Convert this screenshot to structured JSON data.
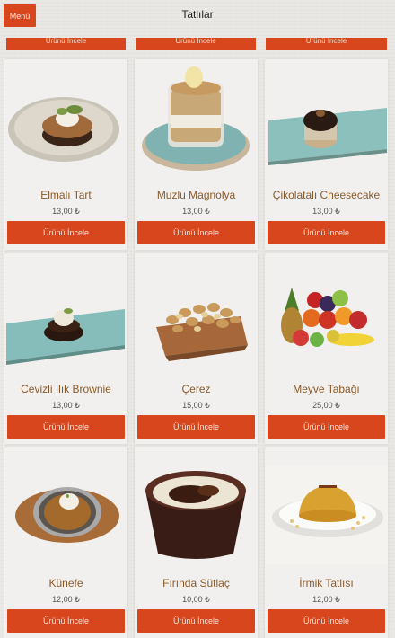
{
  "header": {
    "menu_label": "Menü",
    "title": "Tatlılar"
  },
  "top_strip_label": "Ürünü İncele",
  "products": [
    {
      "name": "Elmalı Tart",
      "price": "13,00 ₺",
      "button": "Ürünü İncele",
      "image": "apple-tart-photo"
    },
    {
      "name": "Muzlu Magnolya",
      "price": "13,00 ₺",
      "button": "Ürünü İncele",
      "image": "banana-magnolia-photo"
    },
    {
      "name": "Çikolatalı Cheesecake",
      "price": "13,00 ₺",
      "button": "Ürünü İncele",
      "image": "chocolate-cheesecake-photo"
    },
    {
      "name": "Cevizli Ilık Brownie",
      "price": "13,00 ₺",
      "button": "Ürünü İncele",
      "image": "walnut-brownie-photo"
    },
    {
      "name": "Çerez",
      "price": "15,00 ₺",
      "button": "Ürünü İncele",
      "image": "nuts-bowl-photo"
    },
    {
      "name": "Meyve Tabağı",
      "price": "25,00 ₺",
      "button": "Ürünü İncele",
      "image": "fruit-plate-photo"
    },
    {
      "name": "Künefe",
      "price": "12,00 ₺",
      "button": "Ürünü İncele",
      "image": "kunefe-photo"
    },
    {
      "name": "Fırında Sütlaç",
      "price": "10,00 ₺",
      "button": "Ürünü İncele",
      "image": "rice-pudding-photo"
    },
    {
      "name": "İrmik Tatlısı",
      "price": "12,00 ₺",
      "button": "Ürünü İncele",
      "image": "semolina-dessert-photo"
    }
  ],
  "colors": {
    "accent": "#d7461d",
    "name_text": "#8a5a2b",
    "card_bg": "#f1f0ee"
  }
}
